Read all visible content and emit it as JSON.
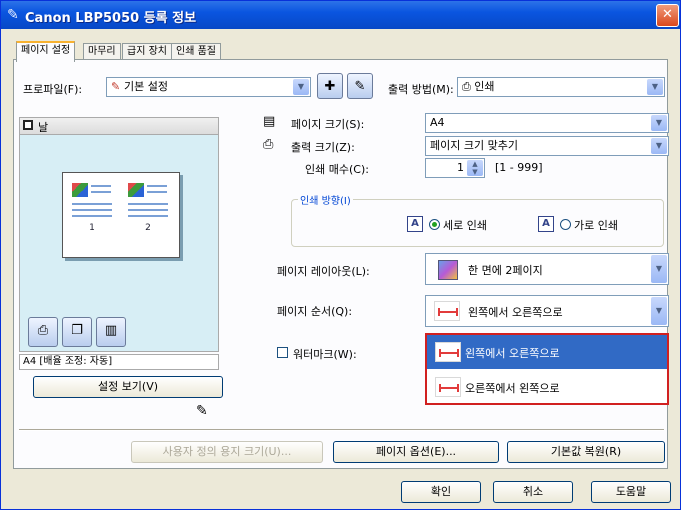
{
  "window": {
    "title": "Canon LBP5050 등록 정보",
    "close_glyph": "✕"
  },
  "tabs": [
    "페이지 설정",
    "마무리",
    "급지 장치",
    "인쇄 품질"
  ],
  "profile": {
    "label": "프로파일(F):",
    "value": "기본 설정"
  },
  "output_method": {
    "label": "출력 방법(M):",
    "value": "인쇄"
  },
  "preview": {
    "label": "날",
    "status": "A4 [배율 조정: 자동]",
    "pages": [
      "1",
      "2"
    ],
    "view_settings_button": "설정 보기(V)"
  },
  "page_size": {
    "label": "페이지 크기(S):",
    "value": "A4"
  },
  "output_size": {
    "label": "출력 크기(Z):",
    "value": "페이지 크기 맞추기"
  },
  "copies": {
    "label": "인쇄 매수(C):",
    "value": "1",
    "range": "[1 - 999]"
  },
  "orientation": {
    "title": "인쇄 방향(I)",
    "portrait_label": "세로 인쇄",
    "landscape_label": "가로 인쇄",
    "portrait_icon_glyph": "A",
    "landscape_icon_glyph": "A",
    "selected": "portrait"
  },
  "page_layout": {
    "label": "페이지 레이아웃(L):",
    "value": "한 면에 2페이지"
  },
  "page_order": {
    "label": "페이지 순서(Q):",
    "value": "왼쪽에서 오른쪽으로",
    "options": [
      "왼쪽에서 오른쪽으로",
      "오른쪽에서 왼쪽으로"
    ],
    "highlighted_option": 0
  },
  "watermark": {
    "label": "워터마크(W):",
    "checked": false
  },
  "footer_buttons": {
    "custom_paper": "사용자 정의 용지 크기(U)...",
    "page_options": "페이지 옵션(E)...",
    "restore_defaults": "기본값 복원(R)"
  },
  "dialog_buttons": {
    "ok": "확인",
    "cancel": "취소",
    "help": "도움말"
  },
  "colors": {
    "title_bar": "#0a55e0",
    "selection": "#316ac5",
    "highlight_border": "#d12020",
    "tab_accent": "#f8b230"
  }
}
